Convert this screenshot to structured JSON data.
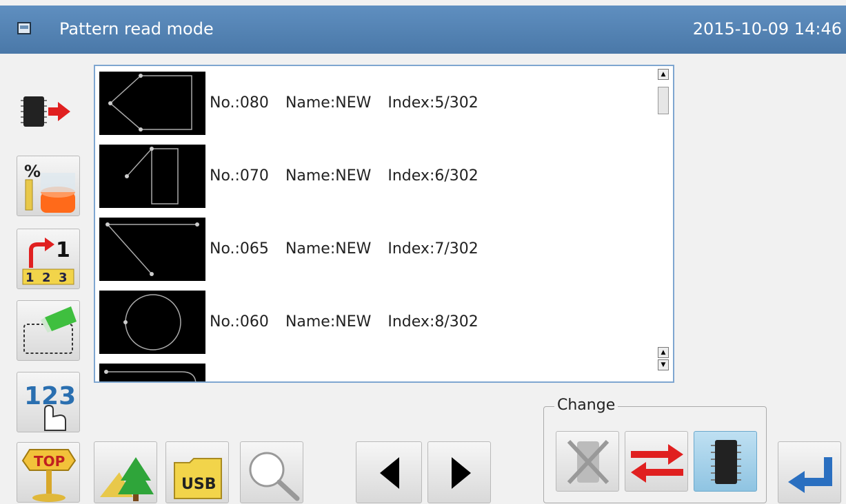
{
  "header": {
    "title": "Pattern read mode",
    "datetime": "2015-10-09 14:46",
    "bar_color": "#5283b5"
  },
  "sidebar": {
    "items": [
      {
        "name": "memory-read-icon"
      },
      {
        "name": "percent-scale-icon"
      },
      {
        "name": "sort-order-icon"
      },
      {
        "name": "area-select-icon"
      },
      {
        "name": "number-input-icon"
      },
      {
        "name": "top-sign-icon"
      }
    ]
  },
  "patterns": [
    {
      "no": "No.:080",
      "name": "Name:NEW",
      "index": "Index:5/302"
    },
    {
      "no": "No.:070",
      "name": "Name:NEW",
      "index": "Index:6/302"
    },
    {
      "no": "No.:065",
      "name": "Name:NEW",
      "index": "Index:7/302"
    },
    {
      "no": "No.:060",
      "name": "Name:NEW",
      "index": "Index:8/302"
    }
  ],
  "change": {
    "label": "Change"
  },
  "toolbar": {
    "buttons": [
      "scenery-icon",
      "usb-icon",
      "magnifier-icon",
      "prev-arrow-icon",
      "next-arrow-icon",
      "disabled-memory-icon",
      "swap-arrows-icon",
      "memory-chip-icon",
      "enter-return-icon"
    ]
  }
}
